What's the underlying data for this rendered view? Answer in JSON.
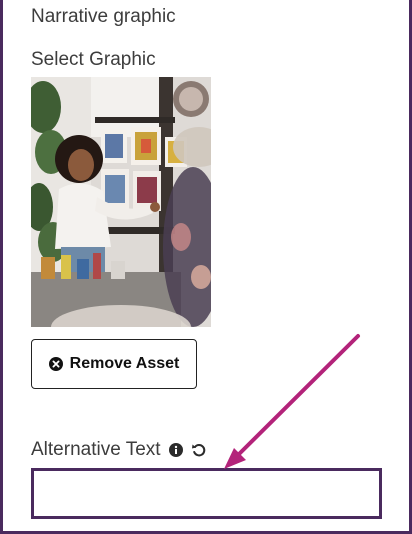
{
  "section": {
    "title": "Narrative graphic"
  },
  "graphic": {
    "label": "Select Graphic",
    "image_icon": "photo-woman-artist-studio"
  },
  "remove_button": {
    "label": "Remove Asset",
    "icon": "close-circle-icon"
  },
  "alt_text": {
    "label": "Alternative Text",
    "info_icon": "info-circle-icon",
    "reset_icon": "undo-icon",
    "value": "",
    "placeholder": ""
  },
  "colors": {
    "frame_border": "#4a2a5e",
    "arrow": "#b3237a",
    "text": "#3d3d3d"
  }
}
